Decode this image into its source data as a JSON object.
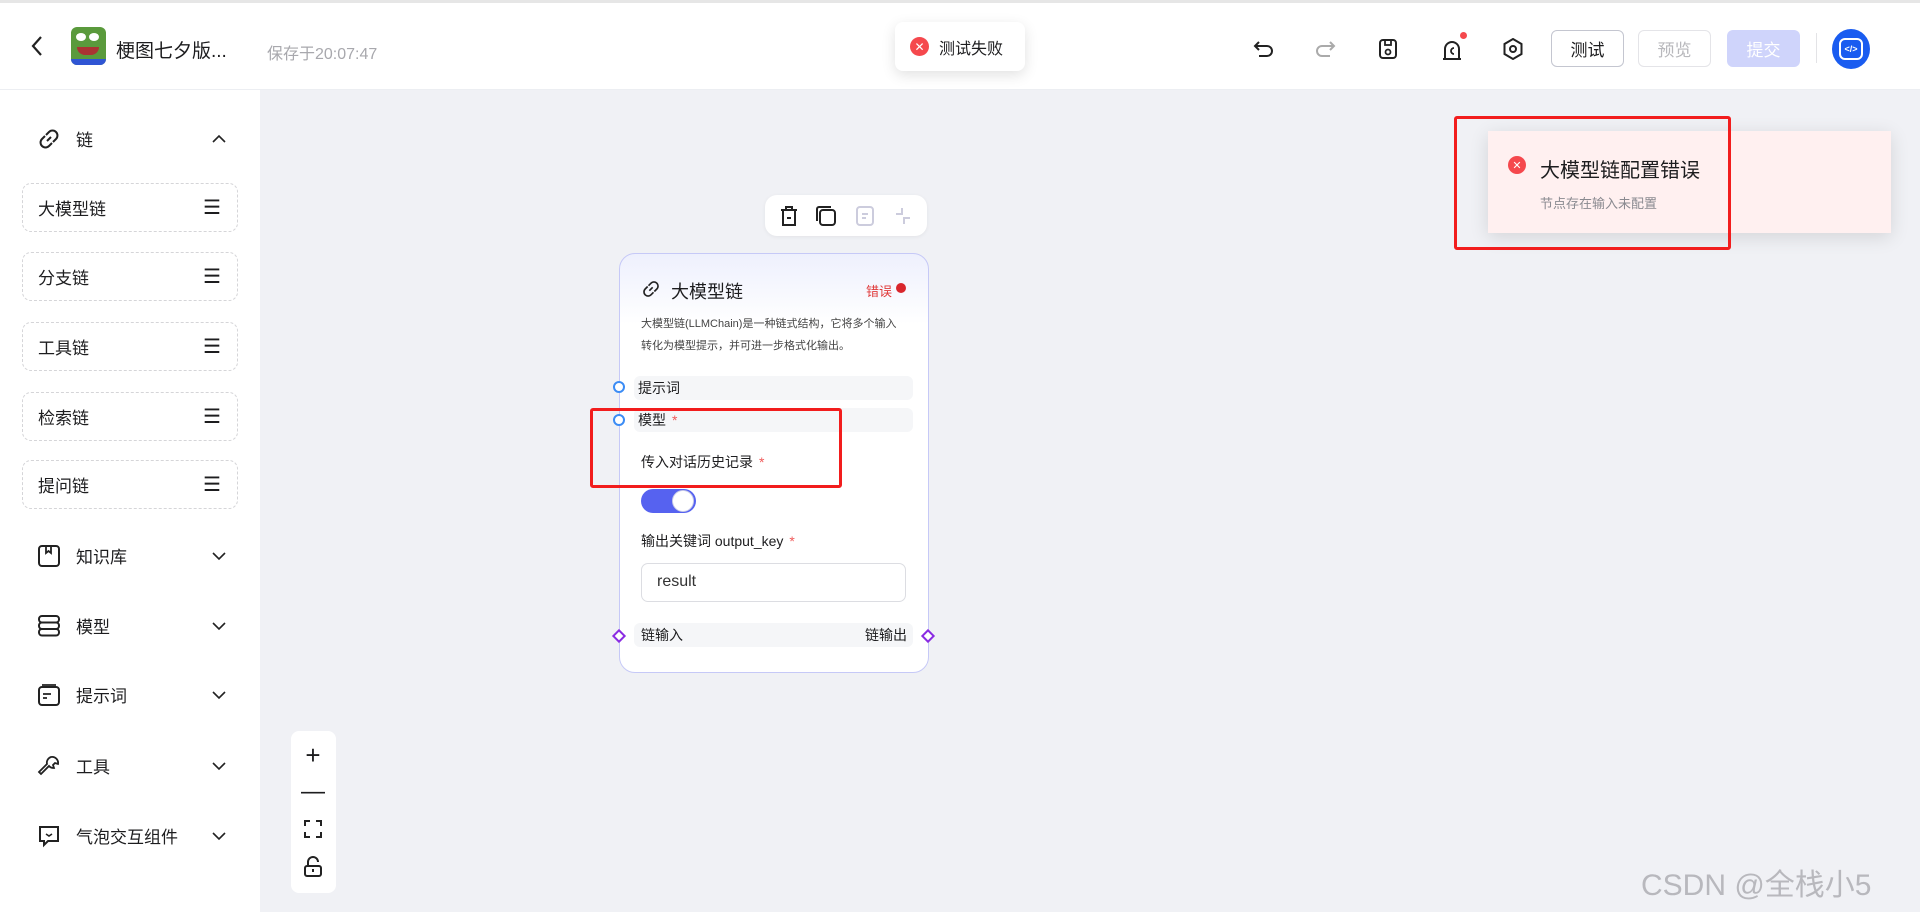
{
  "header": {
    "back": "back",
    "project_name": "梗图七夕版...",
    "saved_text": "保存于20:07:47",
    "toast": "测试失败",
    "buttons": {
      "test": "测试",
      "preview": "预览",
      "submit": "提交"
    },
    "accent": "#4f6ef7"
  },
  "sidebar": {
    "chain_section": "链",
    "chain_items": [
      "大模型链",
      "分支链",
      "工具链",
      "检索链",
      "提问链"
    ],
    "groups": [
      "知识库",
      "模型",
      "提示词",
      "工具",
      "气泡交互组件"
    ]
  },
  "node": {
    "title": "大模型链",
    "status": "错误",
    "description_1": "大模型链(LLMChain)是一种链式结构，它将多个输入",
    "description_2": "转化为模型提示，并可进一步格式化输出。",
    "inputs": [
      "提示词",
      "模型"
    ],
    "history_label": "传入对话历史记录",
    "history_enabled": true,
    "output_key_label": "输出关键词 output_key",
    "output_key_value": "result",
    "chain_in": "链输入",
    "chain_out": "链输出",
    "required_mark": "*"
  },
  "notification": {
    "title": "大模型链配置错误",
    "message": "节点存在输入未配置"
  },
  "watermark": "CSDN @全栈小5"
}
